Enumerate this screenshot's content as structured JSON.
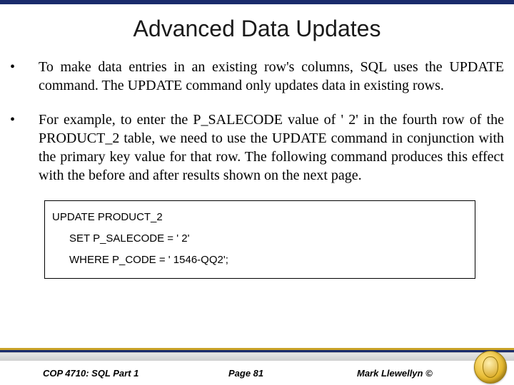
{
  "title": "Advanced Data Updates",
  "bullets": [
    "To make data entries in an existing row's columns, SQL uses the UPDATE command.  The UPDATE command only updates data in existing rows.",
    "For example, to enter the P_SALECODE value of ' 2' in the fourth row of the PRODUCT_2 table, we need to use the UPDATE command in conjunction with the primary key value for that row.  The following command produces this effect with the before and after results shown on the next page."
  ],
  "code": {
    "line1": "UPDATE PRODUCT_2",
    "line2": "SET P_SALECODE = ' 2'",
    "line3": "WHERE P_CODE = ' 1546-QQ2';"
  },
  "footer": {
    "course": "COP 4710: SQL Part 1",
    "page": "Page 81",
    "author": "Mark Llewellyn ©"
  }
}
